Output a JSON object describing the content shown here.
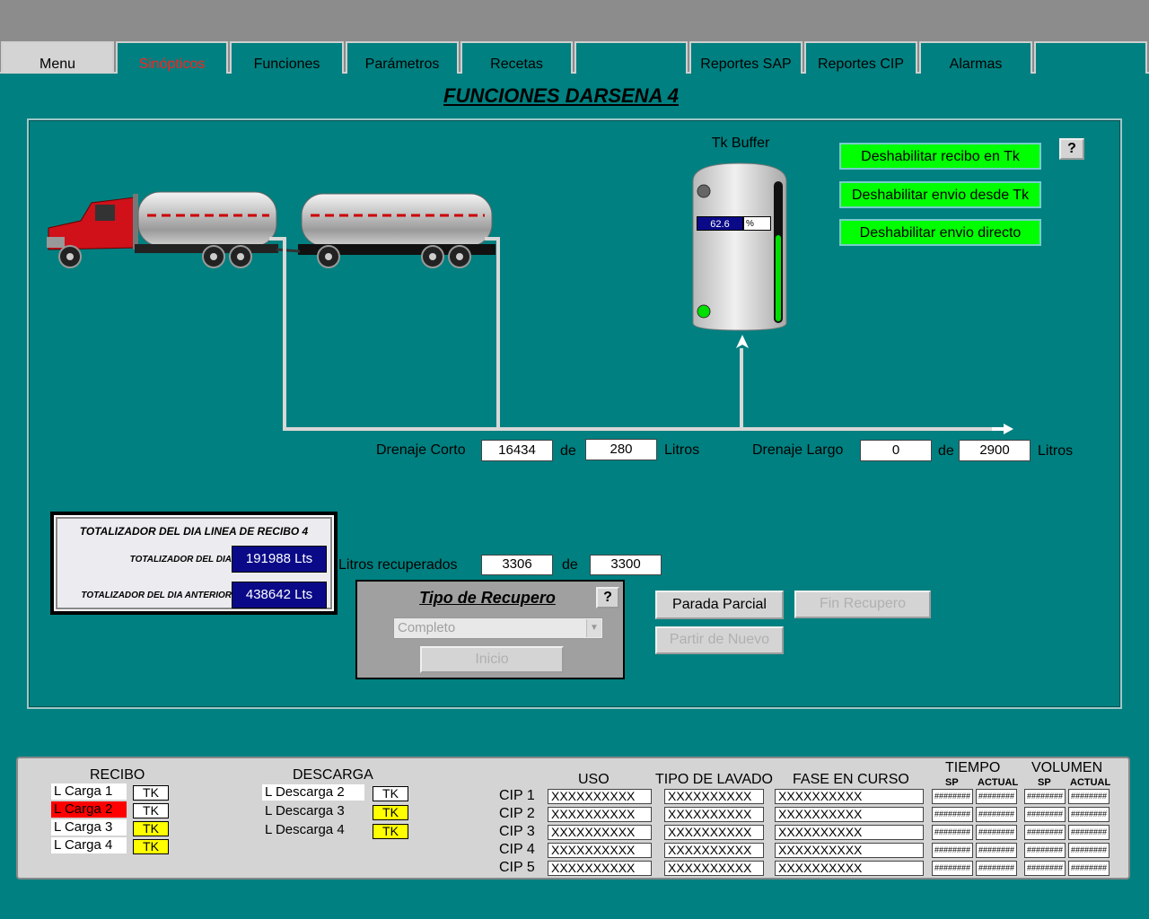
{
  "tabs": [
    "Menu",
    "Sinópticos",
    "Funciones",
    "Parámetros",
    "Recetas",
    "",
    "Reportes SAP",
    "Reportes CIP",
    "Alarmas",
    ""
  ],
  "page_title": "FUNCIONES DARSENA 4",
  "tank": {
    "label": "Tk Buffer",
    "level_value": "62.6",
    "level_unit": "%",
    "level_fraction": 0.626
  },
  "buttons": {
    "disable_receive": "Deshabilitar recibo en Tk",
    "disable_send": "Deshabilitar envio desde Tk",
    "disable_direct": "Deshabilitar envio directo",
    "help": "?"
  },
  "drain": {
    "short_label": "Drenaje Corto",
    "short_value": "16434",
    "short_target": "280",
    "long_label": "Drenaje Largo",
    "long_value": "0",
    "long_target": "2900",
    "de": "de",
    "unit": "Litros"
  },
  "totalizer": {
    "title": "TOTALIZADOR DEL DIA LINEA DE RECIBO 4",
    "day_label": "TOTALIZADOR DEL DIA",
    "day_value": "191988 Lts",
    "prev_label": "TOTALIZADOR DEL DIA ANTERIOR",
    "prev_value": "438642 Lts"
  },
  "recovered": {
    "label": "Litros recuperados",
    "value": "3306",
    "de": "de",
    "target": "3300"
  },
  "recupero": {
    "title": "Tipo de Recupero",
    "select": "Completo",
    "start": "Inicio",
    "help": "?"
  },
  "actions": {
    "partial_stop": "Parada Parcial",
    "end_recovery": "Fin Recupero",
    "restart": "Partir de Nuevo"
  },
  "status": {
    "recibo_title": "RECIBO",
    "recibo": [
      {
        "label": "L Carga 1",
        "tk": "TK",
        "alarm": false,
        "tk_yellow": false
      },
      {
        "label": "L Carga 2",
        "tk": "TK",
        "alarm": true,
        "tk_yellow": false
      },
      {
        "label": "L Carga 3",
        "tk": "TK",
        "alarm": false,
        "tk_yellow": true
      },
      {
        "label": "L Carga 4",
        "tk": "TK",
        "alarm": false,
        "tk_yellow": true
      }
    ],
    "descarga_title": "DESCARGA",
    "descarga": [
      {
        "label": "L Descarga 2",
        "tk": "TK",
        "tk_yellow": false
      },
      {
        "label": "L Descarga 3",
        "tk": "TK",
        "tk_yellow": true
      },
      {
        "label": "L Descarga 4",
        "tk": "TK",
        "tk_yellow": true
      }
    ]
  },
  "cip": {
    "col_uso": "USO",
    "col_tipo": "TIPO DE LAVADO",
    "col_fase": "FASE EN CURSO",
    "col_tiempo": "TIEMPO",
    "col_volumen": "VOLUMEN",
    "sp": "SP",
    "actual": "ACTUAL",
    "rows": [
      {
        "name": "CIP 1",
        "uso": "XXXXXXXXXX",
        "tipo": "XXXXXXXXXX",
        "fase": "XXXXXXXXXX",
        "t_sp": "########",
        "t_act": "########",
        "v_sp": "########",
        "v_act": "########"
      },
      {
        "name": "CIP 2",
        "uso": "XXXXXXXXXX",
        "tipo": "XXXXXXXXXX",
        "fase": "XXXXXXXXXX",
        "t_sp": "########",
        "t_act": "########",
        "v_sp": "########",
        "v_act": "########"
      },
      {
        "name": "CIP 3",
        "uso": "XXXXXXXXXX",
        "tipo": "XXXXXXXXXX",
        "fase": "XXXXXXXXXX",
        "t_sp": "########",
        "t_act": "########",
        "v_sp": "########",
        "v_act": "########"
      },
      {
        "name": "CIP 4",
        "uso": "XXXXXXXXXX",
        "tipo": "XXXXXXXXXX",
        "fase": "XXXXXXXXXX",
        "t_sp": "########",
        "t_act": "########",
        "v_sp": "########",
        "v_act": "########"
      },
      {
        "name": "CIP 5",
        "uso": "XXXXXXXXXX",
        "tipo": "XXXXXXXXXX",
        "fase": "XXXXXXXXXX",
        "t_sp": "########",
        "t_act": "########",
        "v_sp": "########",
        "v_act": "########"
      }
    ]
  }
}
